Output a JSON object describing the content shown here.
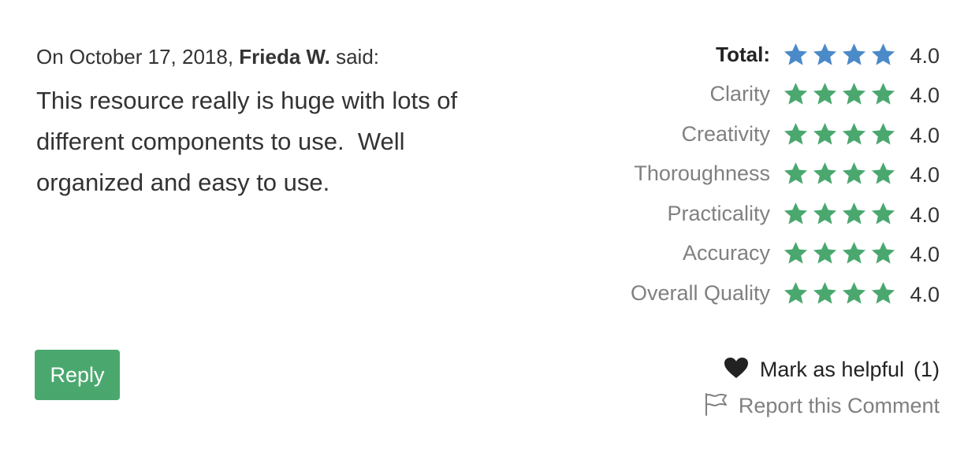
{
  "review": {
    "byline_prefix": "On October 17, 2018,",
    "author": "Frieda W.",
    "byline_suffix": "said:",
    "body": "This resource really is huge with lots of\ndifferent components to use.  Well\norganized and easy to use."
  },
  "ratings": [
    {
      "label": "Total:",
      "value": "4.0",
      "stars": 4,
      "color": "#4a8ac8"
    },
    {
      "label": "Clarity",
      "value": "4.0",
      "stars": 4,
      "color": "#4aa86f"
    },
    {
      "label": "Creativity",
      "value": "4.0",
      "stars": 4,
      "color": "#4aa86f"
    },
    {
      "label": "Thoroughness",
      "value": "4.0",
      "stars": 4,
      "color": "#4aa86f"
    },
    {
      "label": "Practicality",
      "value": "4.0",
      "stars": 4,
      "color": "#4aa86f"
    },
    {
      "label": "Accuracy",
      "value": "4.0",
      "stars": 4,
      "color": "#4aa86f"
    },
    {
      "label": "Overall Quality",
      "value": "4.0",
      "stars": 4,
      "color": "#4aa86f"
    }
  ],
  "actions": {
    "reply_label": "Reply",
    "helpful_label": "Mark as helpful",
    "helpful_count": "(1)",
    "report_label": "Report this Comment",
    "heart_icon": "heart-icon",
    "flag_icon": "flag-icon"
  },
  "colors": {
    "accent_green": "#4aa86f",
    "total_blue": "#4a8ac8",
    "muted_text": "#808080"
  }
}
